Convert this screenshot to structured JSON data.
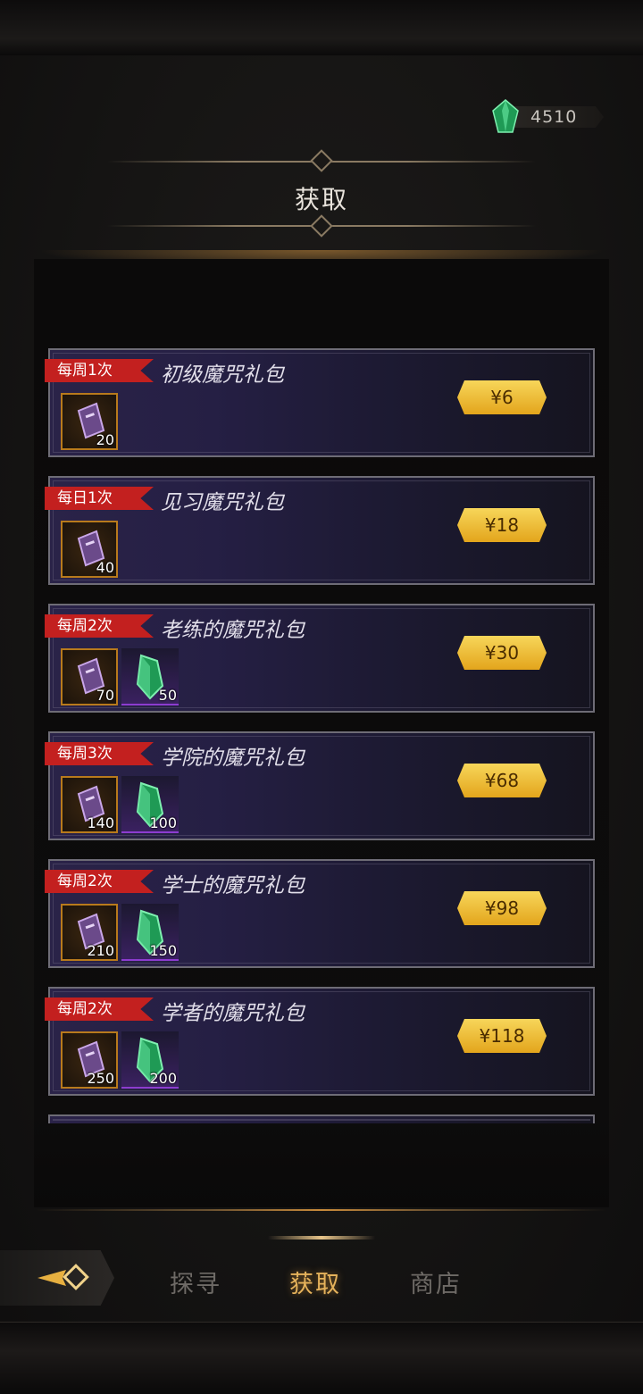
{
  "currency": {
    "icon": "green-gem-icon",
    "value": "4510"
  },
  "header": {
    "title": "获取"
  },
  "packs": [
    {
      "tag": "每周1次",
      "name": "初级魔咒礼包",
      "price": "¥6",
      "items": [
        {
          "icon": "spell-scroll-icon",
          "qty": "20"
        }
      ]
    },
    {
      "tag": "每日1次",
      "name": "见习魔咒礼包",
      "price": "¥18",
      "items": [
        {
          "icon": "spell-scroll-icon",
          "qty": "40"
        }
      ]
    },
    {
      "tag": "每周2次",
      "name": "老练的魔咒礼包",
      "price": "¥30",
      "items": [
        {
          "icon": "spell-scroll-icon",
          "qty": "70"
        },
        {
          "icon": "green-gem-icon",
          "qty": "50"
        }
      ]
    },
    {
      "tag": "每周3次",
      "name": "学院的魔咒礼包",
      "price": "¥68",
      "items": [
        {
          "icon": "spell-scroll-icon",
          "qty": "140"
        },
        {
          "icon": "green-gem-icon",
          "qty": "100"
        }
      ]
    },
    {
      "tag": "每周2次",
      "name": "学士的魔咒礼包",
      "price": "¥98",
      "items": [
        {
          "icon": "spell-scroll-icon",
          "qty": "210"
        },
        {
          "icon": "green-gem-icon",
          "qty": "150"
        }
      ]
    },
    {
      "tag": "每周2次",
      "name": "学者的魔咒礼包",
      "price": "¥118",
      "items": [
        {
          "icon": "spell-scroll-icon",
          "qty": "250"
        },
        {
          "icon": "green-gem-icon",
          "qty": "200"
        }
      ]
    }
  ],
  "nav": {
    "back_icon": "back-arrow-icon",
    "tabs": [
      {
        "label": "探寻",
        "active": false
      },
      {
        "label": "获取",
        "active": true
      },
      {
        "label": "商店",
        "active": false
      }
    ]
  }
}
